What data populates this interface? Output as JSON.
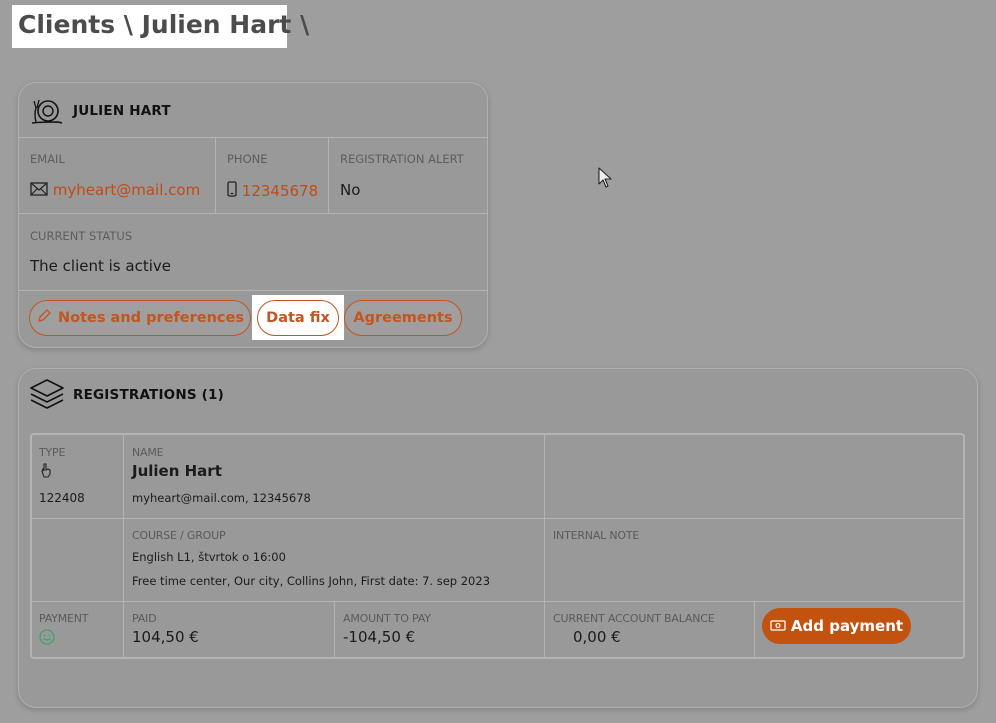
{
  "breadcrumb": "Clients \\ Julien Hart \\",
  "client": {
    "name": "JULIEN HART",
    "email_label": "EMAIL",
    "email": "myheart@mail.com",
    "phone_label": "PHONE",
    "phone": "12345678",
    "reg_alert_label": "REGISTRATION ALERT",
    "reg_alert": "No",
    "status_label": "CURRENT STATUS",
    "status": "The client is active",
    "buttons": {
      "notes": "Notes and preferences",
      "data_fix": "Data fix",
      "agreements": "Agreements"
    }
  },
  "registrations": {
    "title": "REGISTRATIONS (1)",
    "type_label": "TYPE",
    "type_id": "122408",
    "name_label": "NAME",
    "name": "Julien Hart",
    "contact": "myheart@mail.com, 12345678",
    "course_label": "COURSE / GROUP",
    "course": "English L1, štvrtok o 16:00",
    "course_details": "Free time center, Our city, Collins John, First date: 7. sep 2023",
    "internal_note_label": "INTERNAL NOTE",
    "payment_label": "PAYMENT",
    "paid_label": "PAID",
    "paid": "104,50 €",
    "amount_label": "AMOUNT TO PAY",
    "amount": "-104,50 €",
    "balance_label": "CURRENT ACCOUNT BALANCE",
    "balance": "0,00 €",
    "add_payment": "Add payment"
  },
  "colors": {
    "accent": "#c4551f",
    "button_fill": "#c4520f",
    "background": "#9e9e9e"
  },
  "icons": [
    "snail-icon",
    "envelope-icon",
    "phone-icon",
    "pencil-icon",
    "layers-icon",
    "hand-icon",
    "smiley-icon",
    "banknote-icon",
    "mouse-cursor-icon"
  ]
}
